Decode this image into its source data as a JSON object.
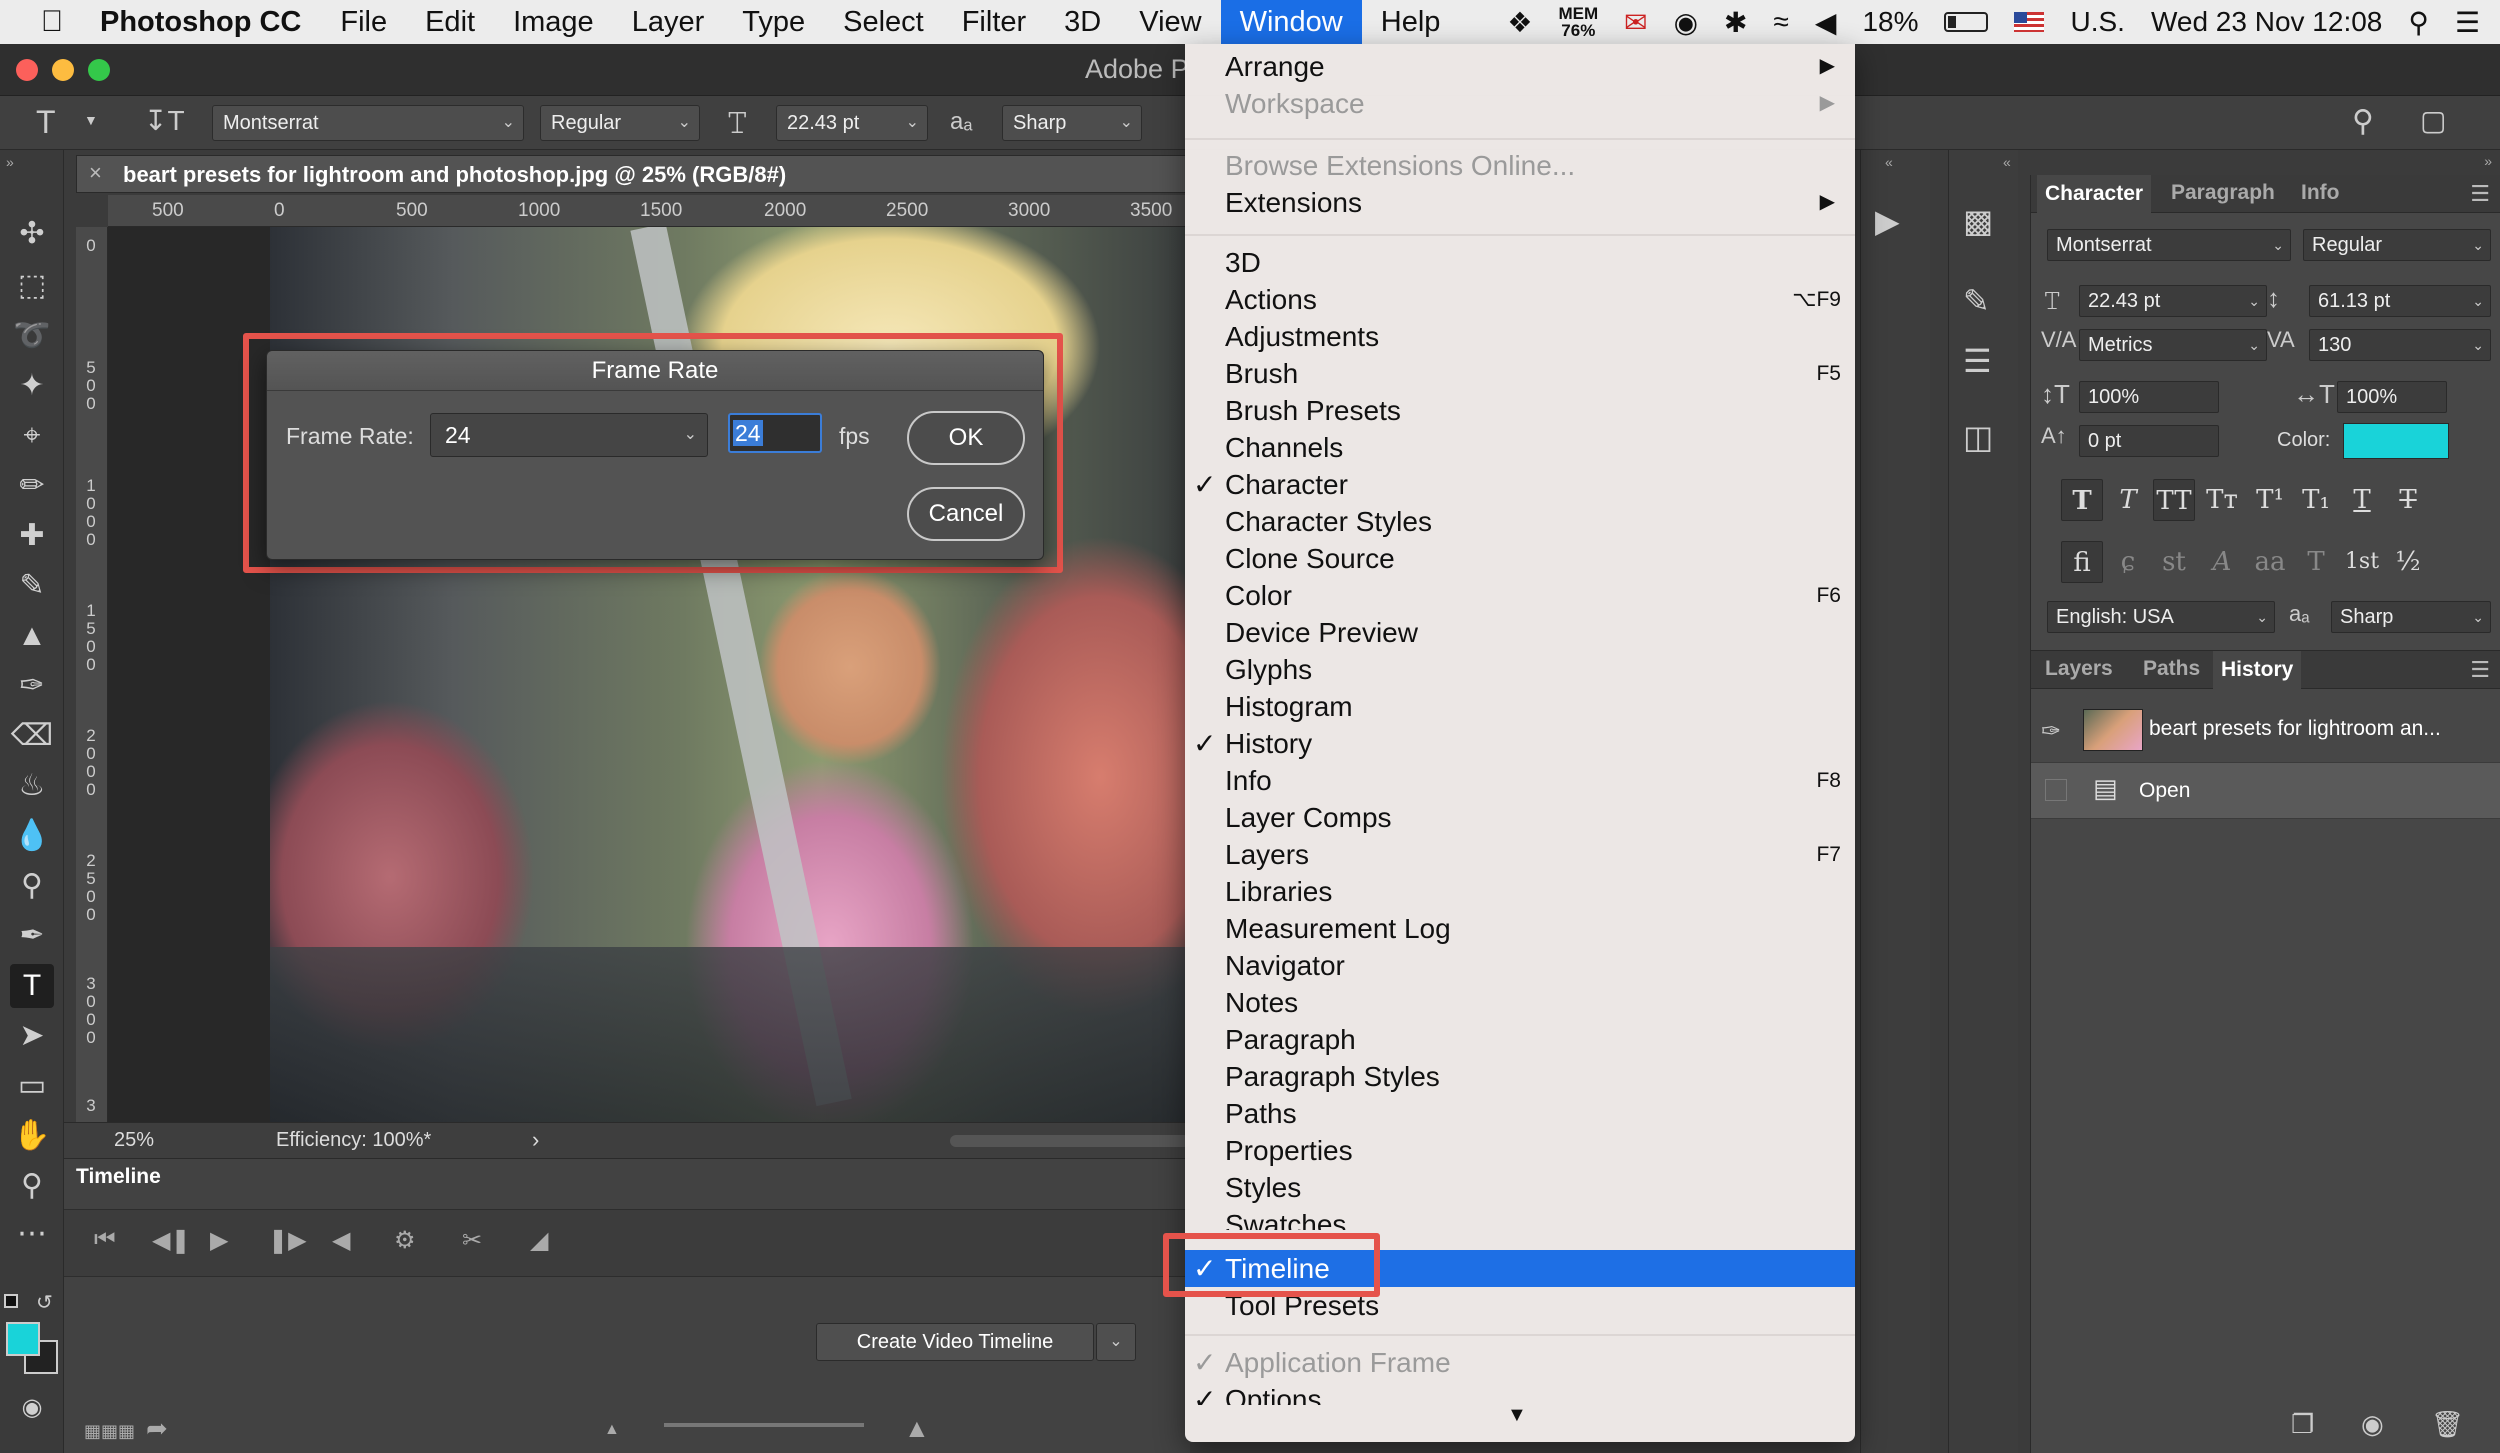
{
  "menubar": {
    "app": "Photoshop CC",
    "items": [
      "File",
      "Edit",
      "Image",
      "Layer",
      "Type",
      "Select",
      "Filter",
      "3D",
      "View",
      "Window",
      "Help"
    ],
    "active": "Window",
    "mem_label": "MEM",
    "mem_value": "76%",
    "battery": "18%",
    "input_source": "U.S.",
    "clock": "Wed 23 Nov  12:08"
  },
  "window": {
    "title": "Adobe P"
  },
  "options": {
    "font_family": "Montserrat",
    "font_style": "Regular",
    "font_size": "22.43 pt",
    "aa_label": "aₐ",
    "antialias": "Sharp"
  },
  "document": {
    "tab_title": "beart presets for lightroom and photoshop.jpg @ 25% (RGB/8#)",
    "ruler_h": [
      "500",
      "0",
      "500",
      "1000",
      "1500",
      "2000",
      "2500",
      "3000",
      "3500"
    ],
    "ruler_v": [
      "0",
      "5\n0\n0",
      "1\n0\n0\n0",
      "1\n5\n0\n0",
      "2\n0\n0\n0",
      "2\n5\n0\n0",
      "3\n0\n0\n0",
      "3"
    ],
    "zoom": "25%",
    "efficiency": "Efficiency: 100%*"
  },
  "dialog": {
    "title": "Frame Rate",
    "label": "Frame Rate:",
    "selected": "24",
    "value": "24",
    "unit": "fps",
    "ok": "OK",
    "cancel": "Cancel"
  },
  "timeline": {
    "tab": "Timeline",
    "create_button": "Create Video Timeline"
  },
  "window_menu": {
    "items": [
      {
        "label": "Arrange",
        "submenu": true
      },
      {
        "label": "Workspace",
        "submenu": true,
        "disabled": true
      },
      {
        "label": "Browse Extensions Online...",
        "disabled": true
      },
      {
        "label": "Extensions",
        "submenu": true
      },
      {
        "label": "3D"
      },
      {
        "label": "Actions",
        "shortcut": "⌥F9"
      },
      {
        "label": "Adjustments"
      },
      {
        "label": "Brush",
        "shortcut": "F5"
      },
      {
        "label": "Brush Presets"
      },
      {
        "label": "Channels"
      },
      {
        "label": "Character",
        "checked": true
      },
      {
        "label": "Character Styles"
      },
      {
        "label": "Clone Source"
      },
      {
        "label": "Color",
        "shortcut": "F6"
      },
      {
        "label": "Device Preview"
      },
      {
        "label": "Glyphs"
      },
      {
        "label": "Histogram"
      },
      {
        "label": "History",
        "checked": true
      },
      {
        "label": "Info",
        "shortcut": "F8"
      },
      {
        "label": "Layer Comps"
      },
      {
        "label": "Layers",
        "shortcut": "F7"
      },
      {
        "label": "Libraries"
      },
      {
        "label": "Measurement Log"
      },
      {
        "label": "Navigator"
      },
      {
        "label": "Notes"
      },
      {
        "label": "Paragraph"
      },
      {
        "label": "Paragraph Styles"
      },
      {
        "label": "Paths"
      },
      {
        "label": "Properties"
      },
      {
        "label": "Styles"
      },
      {
        "label": "Swatches"
      },
      {
        "label": "Timeline",
        "checked": true,
        "highlighted": true
      },
      {
        "label": "Tool Presets"
      },
      {
        "label": "Application Frame",
        "checked": true,
        "disabled": true
      },
      {
        "label": "Options",
        "checked": true
      }
    ],
    "check_mark": "✓",
    "submenu_mark": "▶",
    "scroll_down": "▼"
  },
  "character_panel": {
    "tabs": [
      "Character",
      "Paragraph",
      "Info"
    ],
    "font_family": "Montserrat",
    "font_style": "Regular",
    "size": "22.43 pt",
    "leading": "61.13 pt",
    "kerning": "Metrics",
    "tracking": "130",
    "vscale": "100%",
    "hscale": "100%",
    "baseline": "0 pt",
    "color_label": "Color:",
    "color": "#19d3d9",
    "language": "English: USA",
    "aa_label": "aₐ",
    "antialias": "Sharp",
    "type_buttons": [
      "T",
      "T",
      "TT",
      "Tт",
      "T¹",
      "T₁",
      "T",
      "T"
    ],
    "opentype_buttons": [
      "fi",
      "ɕ",
      "st",
      "A",
      "aa",
      "T",
      "1st",
      "½"
    ]
  },
  "history_panel": {
    "tabs": [
      "Layers",
      "Paths",
      "History"
    ],
    "snapshot": "beart presets for lightroom an...",
    "states": [
      "Open"
    ]
  },
  "colors": {
    "accent": "#1e6fe5",
    "highlight_box": "#e5534b",
    "foreground_swatch": "#19d3d9"
  }
}
